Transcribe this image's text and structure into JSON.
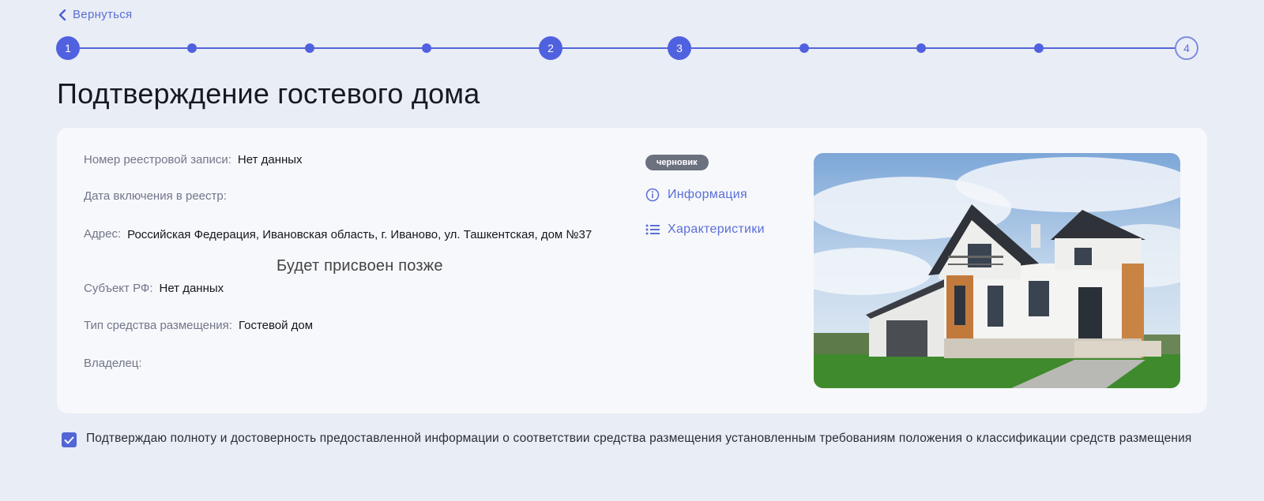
{
  "nav": {
    "back_label": "Вернуться"
  },
  "stepper": {
    "steps": [
      {
        "label": "1",
        "state": "done"
      },
      {
        "label": "",
        "state": "dot"
      },
      {
        "label": "",
        "state": "dot"
      },
      {
        "label": "",
        "state": "dot"
      },
      {
        "label": "2",
        "state": "done"
      },
      {
        "label": "3",
        "state": "current"
      },
      {
        "label": "",
        "state": "dot"
      },
      {
        "label": "",
        "state": "dot"
      },
      {
        "label": "",
        "state": "dot"
      },
      {
        "label": "4",
        "state": "pending"
      }
    ]
  },
  "page": {
    "title": "Подтверждение гостевого дома"
  },
  "details": {
    "registry_number_label": "Номер реестровой записи:",
    "registry_number_value": "Нет данных",
    "inclusion_date_label": "Дата включения в реестр:",
    "address_label": "Адрес:",
    "address_value": "Российская Федерация, Ивановская область, г. Иваново, ул. Ташкентская, дом №37",
    "assigned_later": "Будет присвоен позже",
    "subject_label": "Субъект РФ:",
    "subject_value": "Нет данных",
    "type_label": "Тип средства размещения:",
    "type_value": "Гостевой дом",
    "owner_label": "Владелец:"
  },
  "status": {
    "badge": "черновик"
  },
  "links": {
    "info": {
      "label": "Информация",
      "icon": "info-circle-icon"
    },
    "characteristics": {
      "label": "Характеристики",
      "icon": "list-icon"
    }
  },
  "confirmation": {
    "checked": true,
    "text": "Подтверждаю полноту и достоверность предоставленной информации о соответствии средства размещения установленным требованиям положения о классификации средств размещения"
  },
  "colors": {
    "accent": "#5061e0",
    "background": "#e9edf5",
    "card": "#f7f8fb",
    "badge": "#6c7180"
  }
}
